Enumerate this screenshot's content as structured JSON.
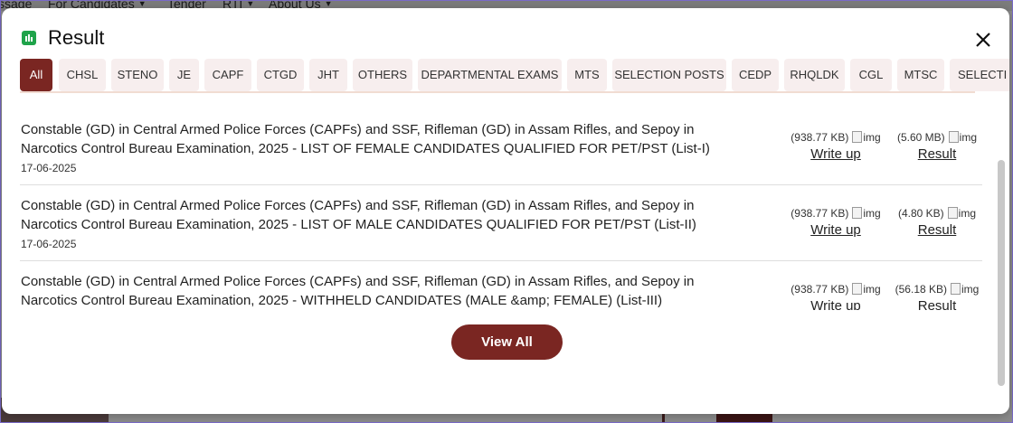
{
  "background_nav": {
    "items": [
      "ssage",
      "For Candidates",
      "Tender",
      "RTI",
      "About Us"
    ]
  },
  "modal": {
    "title": "Result",
    "title_icon": "bar-chart-icon",
    "close_icon": "close-icon",
    "accent_color": "#7a2622",
    "tabs": [
      {
        "label": "All",
        "active": true
      },
      {
        "label": "CHSL"
      },
      {
        "label": "STENO"
      },
      {
        "label": "JE"
      },
      {
        "label": "CAPF"
      },
      {
        "label": "CTGD"
      },
      {
        "label": "JHT"
      },
      {
        "label": "OTHERS"
      },
      {
        "label": "DEPARTMENTAL EXAMS"
      },
      {
        "label": "MTS"
      },
      {
        "label": "SELECTION POSTS"
      },
      {
        "label": "CEDP"
      },
      {
        "label": "RHQLDK"
      },
      {
        "label": "CGL"
      },
      {
        "label": "MTSC"
      },
      {
        "label": "SELECTI"
      }
    ],
    "results": [
      {
        "title": "Constable (GD) in Central Armed Police Forces (CAPFs) and SSF, Rifleman (GD) in Assam Rifles, and Sepoy in Narcotics Control Bureau Examination, 2025 - LIST OF FEMALE CANDIDATES QUALIFIED FOR PET/PST (List-I)",
        "date": "17-06-2025",
        "writeup_size": "(938.77 KB)",
        "writeup_label": "Write up",
        "result_size": "(5.60 MB)",
        "result_label": "Result",
        "img_alt": "img"
      },
      {
        "title": "Constable (GD) in Central Armed Police Forces (CAPFs) and SSF, Rifleman (GD) in Assam Rifles, and Sepoy in Narcotics Control Bureau Examination, 2025 - LIST OF MALE CANDIDATES QUALIFIED FOR PET/PST (List-II)",
        "date": "17-06-2025",
        "writeup_size": "(938.77 KB)",
        "writeup_label": "Write up",
        "result_size": "(4.80 KB)",
        "result_label": "Result",
        "img_alt": "img"
      },
      {
        "title": "Constable (GD) in Central Armed Police Forces (CAPFs) and SSF, Rifleman (GD) in Assam Rifles, and Sepoy in Narcotics Control Bureau Examination, 2025 - WITHHELD CANDIDATES (MALE &amp; FEMALE) (List-III)",
        "date": "",
        "writeup_size": "(938.77 KB)",
        "writeup_label": "Write up",
        "result_size": "(56.18 KB)",
        "result_label": "Result",
        "img_alt": "img"
      }
    ],
    "view_all_label": "View All"
  }
}
